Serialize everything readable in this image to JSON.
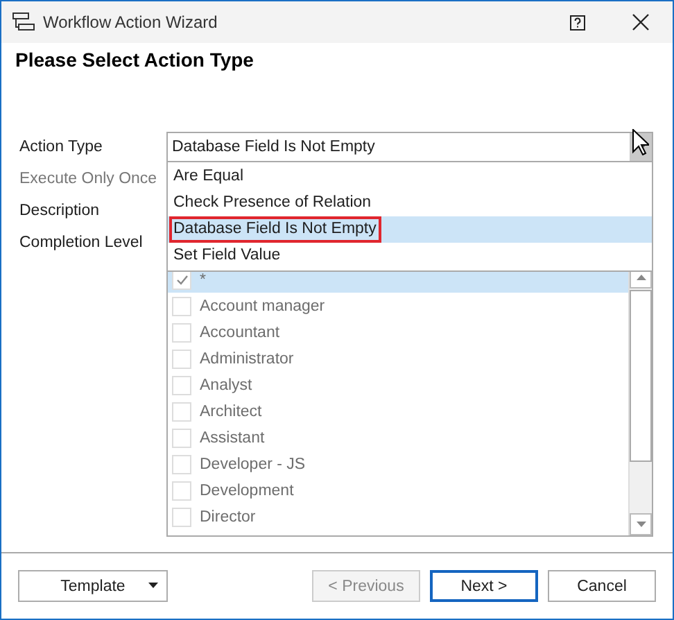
{
  "window": {
    "title": "Workflow Action Wizard"
  },
  "heading": "Please Select Action Type",
  "fields": [
    {
      "label": "Action Type",
      "disabled": false
    },
    {
      "label": "Execute Only Once",
      "disabled": true
    },
    {
      "label": "Description",
      "disabled": false
    },
    {
      "label": "Completion Level",
      "disabled": false
    }
  ],
  "action_type": {
    "value": "Database Field Is Not Empty",
    "expanded": true,
    "options": [
      {
        "label": "Are Equal",
        "selected": false
      },
      {
        "label": "Check Presence of Relation",
        "selected": false
      },
      {
        "label": "Database Field Is Not Empty",
        "selected": true
      },
      {
        "label": "Set Field Value",
        "selected": false
      }
    ]
  },
  "completion_levels": [
    {
      "label": "*",
      "checked": true,
      "selected": true
    },
    {
      "label": "Account manager",
      "checked": false,
      "selected": false
    },
    {
      "label": "Accountant",
      "checked": false,
      "selected": false
    },
    {
      "label": "Administrator",
      "checked": false,
      "selected": false
    },
    {
      "label": "Analyst",
      "checked": false,
      "selected": false
    },
    {
      "label": "Architect",
      "checked": false,
      "selected": false
    },
    {
      "label": "Assistant",
      "checked": false,
      "selected": false
    },
    {
      "label": "Developer - JS",
      "checked": false,
      "selected": false
    },
    {
      "label": "Development",
      "checked": false,
      "selected": false
    },
    {
      "label": "Director",
      "checked": false,
      "selected": false
    }
  ],
  "buttons": [
    {
      "label": "Template",
      "kind": "split",
      "disabled": false,
      "default": false
    },
    {
      "label": "< Previous",
      "kind": "plain",
      "disabled": true,
      "default": false
    },
    {
      "label": "Next >",
      "kind": "plain",
      "disabled": false,
      "default": true
    },
    {
      "label": "Cancel",
      "kind": "plain",
      "disabled": false,
      "default": false
    }
  ]
}
